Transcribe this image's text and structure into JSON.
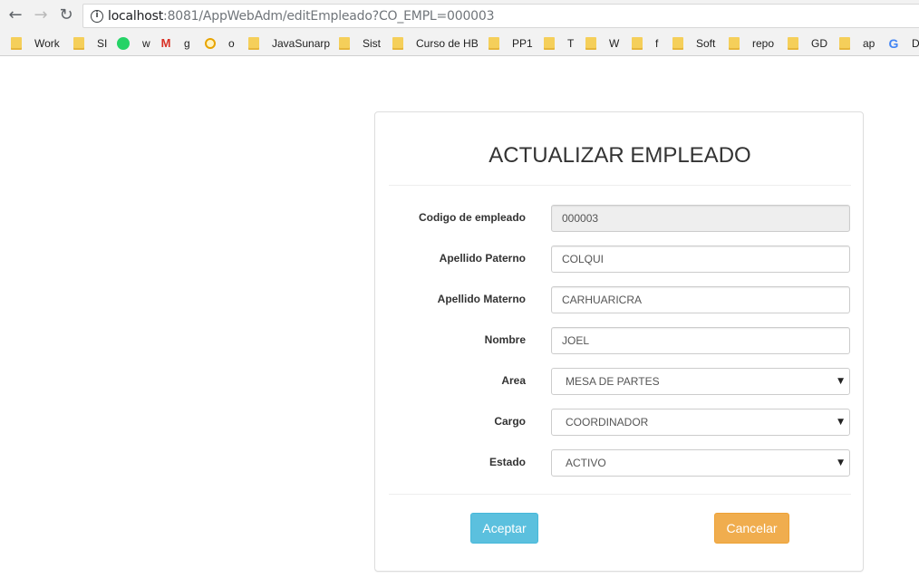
{
  "browser": {
    "url_host": "localhost",
    "url_rest": ":8081/AppWebAdm/editEmpleado?CO_EMPL=000003",
    "bookmarks": [
      "Work",
      "SI",
      "w",
      "g",
      "o",
      "JavaSunarp",
      "Sist",
      "Curso de HB",
      "PP1",
      "T",
      "W",
      "f",
      "Soft",
      "repo",
      "GD",
      "ap",
      "D"
    ]
  },
  "form": {
    "title": "ACTUALIZAR EMPLEADO",
    "fields": [
      {
        "label": "Codigo de empleado",
        "value": "000003"
      },
      {
        "label": "Apellido Paterno",
        "value": "COLQUI"
      },
      {
        "label": "Apellido Materno",
        "value": "CARHUARICRA"
      },
      {
        "label": "Nombre",
        "value": "JOEL"
      },
      {
        "label": "Area",
        "value": "MESA DE PARTES"
      },
      {
        "label": "Cargo",
        "value": "COORDINADOR"
      },
      {
        "label": "Estado",
        "value": "ACTIVO"
      }
    ],
    "accept_label": "Aceptar",
    "cancel_label": "Cancelar",
    "accept_color": "#5bc0de",
    "cancel_color": "#f0ad4e"
  }
}
